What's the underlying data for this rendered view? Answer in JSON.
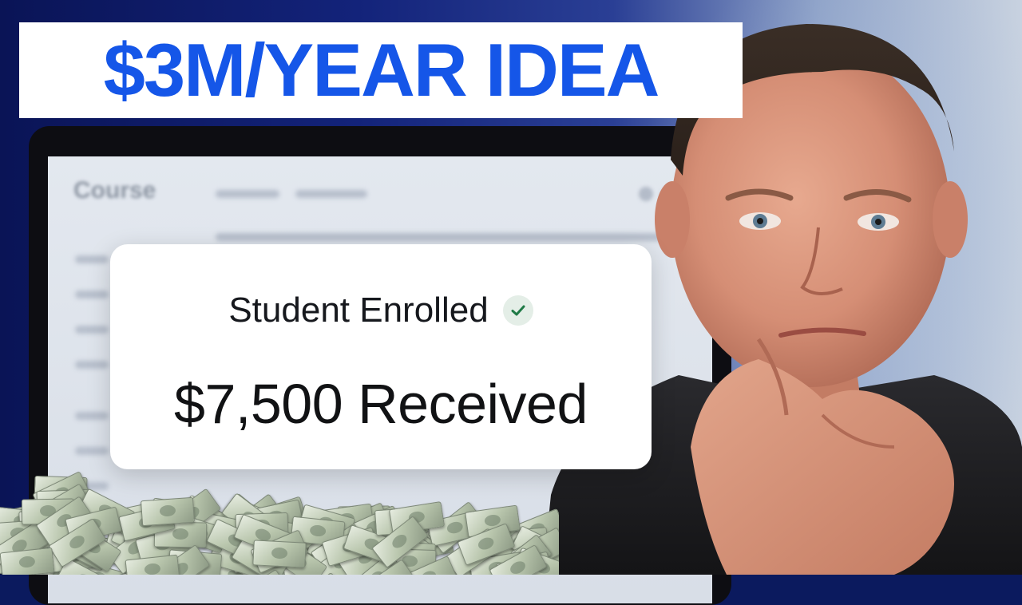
{
  "banner": {
    "title": "$3M/YEAR IDEA"
  },
  "screen": {
    "heading": "Course"
  },
  "notification": {
    "status": "Student Enrolled",
    "amount": "$7,500 Received"
  },
  "colors": {
    "banner_text": "#1556e8",
    "background": "#0b1a5e",
    "check_green": "#1f7a46"
  },
  "icons": {
    "status_check": "check-circle-icon"
  }
}
